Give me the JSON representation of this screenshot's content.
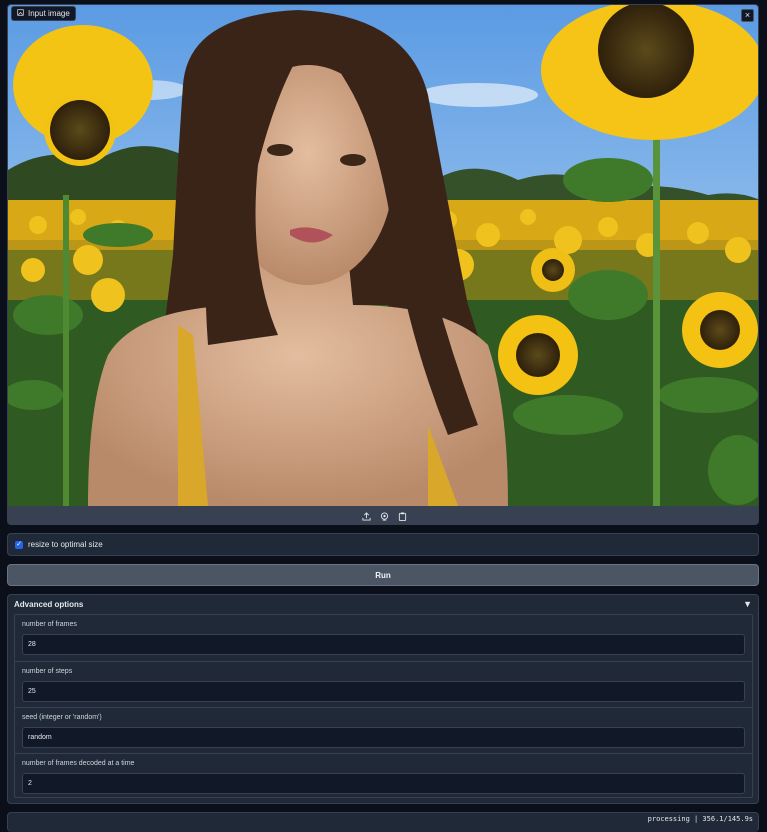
{
  "image_panel": {
    "label": "Input image",
    "close_symbol": "×",
    "toolbar": [
      "upload-icon",
      "webcam-icon",
      "clipboard-icon"
    ]
  },
  "resize": {
    "label": "resize to optimal size",
    "checked": true,
    "check_symbol": "✓"
  },
  "run_button": {
    "label": "Run"
  },
  "advanced": {
    "title": "Advanced options",
    "toggle_symbol": "▼",
    "fields": [
      {
        "label": "number of frames",
        "value": "28"
      },
      {
        "label": "number of steps",
        "value": "25"
      },
      {
        "label": "seed (integer or 'random')",
        "value": "random"
      },
      {
        "label": "number of frames decoded at a time",
        "value": "2"
      }
    ]
  },
  "status": {
    "text": "processing | 356.1/145.9s"
  },
  "colors": {
    "background": "#0b0f19",
    "panel": "#1f2937",
    "border": "#374151",
    "accent": "#2563eb"
  }
}
